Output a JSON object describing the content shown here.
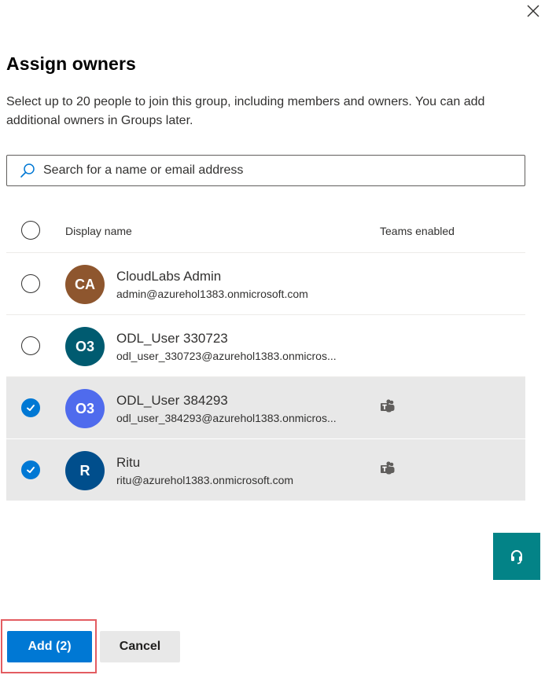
{
  "panel": {
    "title": "Assign owners",
    "description": "Select up to 20 people to join this group, including members and owners. You can add additional owners in Groups later.",
    "close_icon": "close-icon"
  },
  "search": {
    "placeholder": "Search for a name or email address",
    "value": "",
    "icon": "search-icon"
  },
  "table": {
    "columns": [
      "Display name",
      "Teams enabled"
    ],
    "select_all_checked": false,
    "rows": [
      {
        "initials": "CA",
        "name": "CloudLabs Admin",
        "email": "admin@azurehol1383.onmicrosoft.com",
        "selected": false,
        "teams_enabled": false,
        "avatar_color": "#8e562e"
      },
      {
        "initials": "O3",
        "name": "ODL_User 330723",
        "email": "odl_user_330723@azurehol1383.onmicros...",
        "selected": false,
        "teams_enabled": false,
        "avatar_color": "#005b70"
      },
      {
        "initials": "O3",
        "name": "ODL_User 384293",
        "email": "odl_user_384293@azurehol1383.onmicros...",
        "selected": true,
        "teams_enabled": true,
        "avatar_color": "#4f6bed"
      },
      {
        "initials": "R",
        "name": "Ritu",
        "email": "ritu@azurehol1383.onmicrosoft.com",
        "selected": true,
        "teams_enabled": true,
        "avatar_color": "#004e8c"
      }
    ]
  },
  "help": {
    "icon": "headset-icon"
  },
  "footer": {
    "add_label": "Add (2)",
    "cancel_label": "Cancel"
  },
  "colors": {
    "primary": "#0078d4",
    "help_button": "#038387",
    "highlight": "#e35c61"
  }
}
